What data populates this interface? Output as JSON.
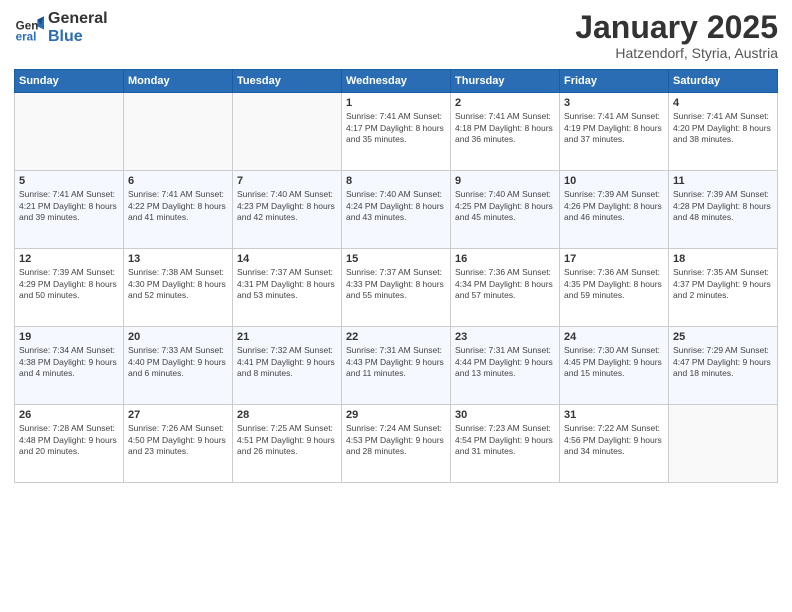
{
  "logo": {
    "general": "General",
    "blue": "Blue"
  },
  "header": {
    "month": "January 2025",
    "location": "Hatzendorf, Styria, Austria"
  },
  "days_of_week": [
    "Sunday",
    "Monday",
    "Tuesday",
    "Wednesday",
    "Thursday",
    "Friday",
    "Saturday"
  ],
  "weeks": [
    [
      {
        "day": "",
        "info": ""
      },
      {
        "day": "",
        "info": ""
      },
      {
        "day": "",
        "info": ""
      },
      {
        "day": "1",
        "info": "Sunrise: 7:41 AM\nSunset: 4:17 PM\nDaylight: 8 hours\nand 35 minutes."
      },
      {
        "day": "2",
        "info": "Sunrise: 7:41 AM\nSunset: 4:18 PM\nDaylight: 8 hours\nand 36 minutes."
      },
      {
        "day": "3",
        "info": "Sunrise: 7:41 AM\nSunset: 4:19 PM\nDaylight: 8 hours\nand 37 minutes."
      },
      {
        "day": "4",
        "info": "Sunrise: 7:41 AM\nSunset: 4:20 PM\nDaylight: 8 hours\nand 38 minutes."
      }
    ],
    [
      {
        "day": "5",
        "info": "Sunrise: 7:41 AM\nSunset: 4:21 PM\nDaylight: 8 hours\nand 39 minutes."
      },
      {
        "day": "6",
        "info": "Sunrise: 7:41 AM\nSunset: 4:22 PM\nDaylight: 8 hours\nand 41 minutes."
      },
      {
        "day": "7",
        "info": "Sunrise: 7:40 AM\nSunset: 4:23 PM\nDaylight: 8 hours\nand 42 minutes."
      },
      {
        "day": "8",
        "info": "Sunrise: 7:40 AM\nSunset: 4:24 PM\nDaylight: 8 hours\nand 43 minutes."
      },
      {
        "day": "9",
        "info": "Sunrise: 7:40 AM\nSunset: 4:25 PM\nDaylight: 8 hours\nand 45 minutes."
      },
      {
        "day": "10",
        "info": "Sunrise: 7:39 AM\nSunset: 4:26 PM\nDaylight: 8 hours\nand 46 minutes."
      },
      {
        "day": "11",
        "info": "Sunrise: 7:39 AM\nSunset: 4:28 PM\nDaylight: 8 hours\nand 48 minutes."
      }
    ],
    [
      {
        "day": "12",
        "info": "Sunrise: 7:39 AM\nSunset: 4:29 PM\nDaylight: 8 hours\nand 50 minutes."
      },
      {
        "day": "13",
        "info": "Sunrise: 7:38 AM\nSunset: 4:30 PM\nDaylight: 8 hours\nand 52 minutes."
      },
      {
        "day": "14",
        "info": "Sunrise: 7:37 AM\nSunset: 4:31 PM\nDaylight: 8 hours\nand 53 minutes."
      },
      {
        "day": "15",
        "info": "Sunrise: 7:37 AM\nSunset: 4:33 PM\nDaylight: 8 hours\nand 55 minutes."
      },
      {
        "day": "16",
        "info": "Sunrise: 7:36 AM\nSunset: 4:34 PM\nDaylight: 8 hours\nand 57 minutes."
      },
      {
        "day": "17",
        "info": "Sunrise: 7:36 AM\nSunset: 4:35 PM\nDaylight: 8 hours\nand 59 minutes."
      },
      {
        "day": "18",
        "info": "Sunrise: 7:35 AM\nSunset: 4:37 PM\nDaylight: 9 hours\nand 2 minutes."
      }
    ],
    [
      {
        "day": "19",
        "info": "Sunrise: 7:34 AM\nSunset: 4:38 PM\nDaylight: 9 hours\nand 4 minutes."
      },
      {
        "day": "20",
        "info": "Sunrise: 7:33 AM\nSunset: 4:40 PM\nDaylight: 9 hours\nand 6 minutes."
      },
      {
        "day": "21",
        "info": "Sunrise: 7:32 AM\nSunset: 4:41 PM\nDaylight: 9 hours\nand 8 minutes."
      },
      {
        "day": "22",
        "info": "Sunrise: 7:31 AM\nSunset: 4:43 PM\nDaylight: 9 hours\nand 11 minutes."
      },
      {
        "day": "23",
        "info": "Sunrise: 7:31 AM\nSunset: 4:44 PM\nDaylight: 9 hours\nand 13 minutes."
      },
      {
        "day": "24",
        "info": "Sunrise: 7:30 AM\nSunset: 4:45 PM\nDaylight: 9 hours\nand 15 minutes."
      },
      {
        "day": "25",
        "info": "Sunrise: 7:29 AM\nSunset: 4:47 PM\nDaylight: 9 hours\nand 18 minutes."
      }
    ],
    [
      {
        "day": "26",
        "info": "Sunrise: 7:28 AM\nSunset: 4:48 PM\nDaylight: 9 hours\nand 20 minutes."
      },
      {
        "day": "27",
        "info": "Sunrise: 7:26 AM\nSunset: 4:50 PM\nDaylight: 9 hours\nand 23 minutes."
      },
      {
        "day": "28",
        "info": "Sunrise: 7:25 AM\nSunset: 4:51 PM\nDaylight: 9 hours\nand 26 minutes."
      },
      {
        "day": "29",
        "info": "Sunrise: 7:24 AM\nSunset: 4:53 PM\nDaylight: 9 hours\nand 28 minutes."
      },
      {
        "day": "30",
        "info": "Sunrise: 7:23 AM\nSunset: 4:54 PM\nDaylight: 9 hours\nand 31 minutes."
      },
      {
        "day": "31",
        "info": "Sunrise: 7:22 AM\nSunset: 4:56 PM\nDaylight: 9 hours\nand 34 minutes."
      },
      {
        "day": "",
        "info": ""
      }
    ]
  ]
}
